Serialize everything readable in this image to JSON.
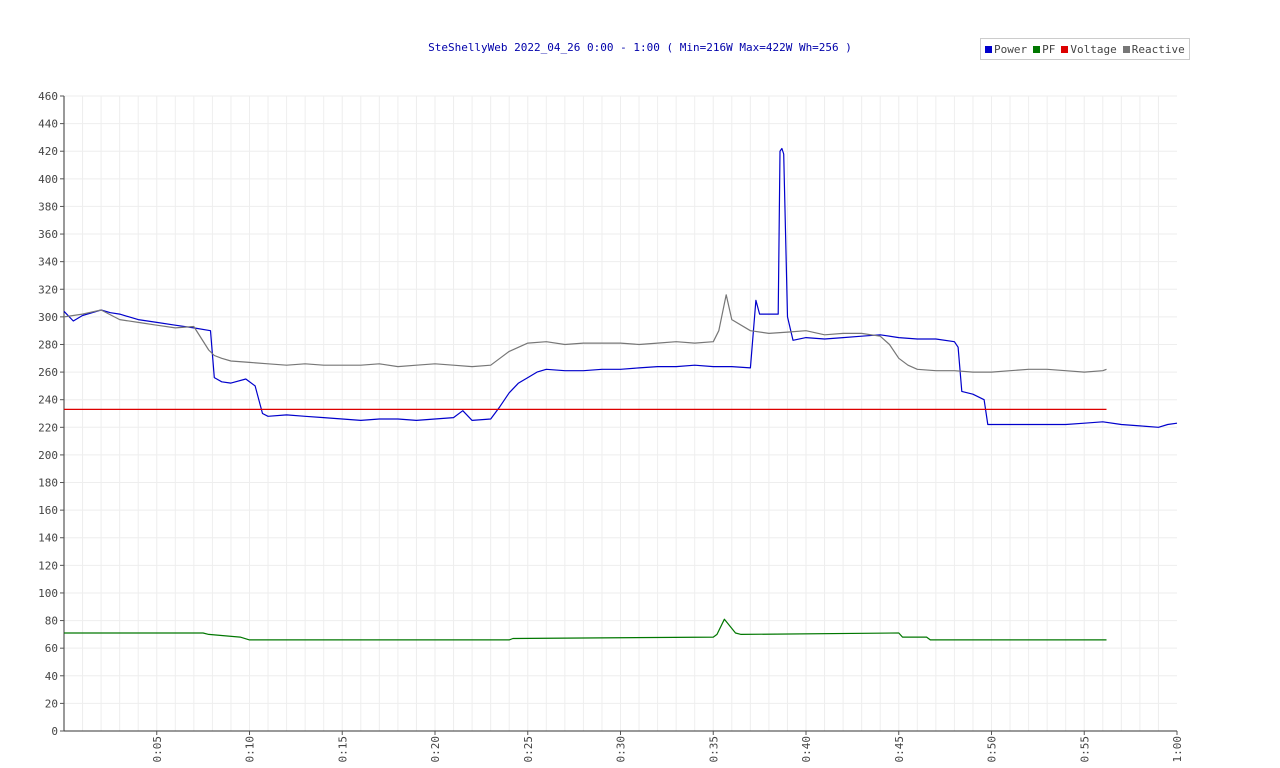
{
  "chart_data": {
    "type": "line",
    "title": "SteShellyWeb 2022_04_26 0:00 - 1:00 ( Min=216W Max=422W  Wh=256 )",
    "ylim": [
      0,
      460
    ],
    "y_ticks": [
      0,
      20,
      40,
      60,
      80,
      100,
      120,
      140,
      160,
      180,
      200,
      220,
      240,
      260,
      280,
      300,
      320,
      340,
      360,
      380,
      400,
      420,
      440,
      460
    ],
    "xlim_minutes": [
      0,
      60
    ],
    "x_tick_minutes": [
      5,
      10,
      15,
      20,
      25,
      30,
      35,
      40,
      45,
      50,
      55,
      60
    ],
    "x_tick_labels": [
      "0:05",
      "0:10",
      "0:15",
      "0:20",
      "0:25",
      "0:30",
      "0:35",
      "0:40",
      "0:45",
      "0:50",
      "0:55",
      "1:00"
    ],
    "grid": true,
    "legend_placement": "top-right",
    "series": [
      {
        "name": "Power",
        "color": "#0000cc",
        "x_minutes": [
          0,
          0.5,
          1,
          2,
          2.5,
          3,
          4,
          5,
          6,
          7,
          7.9,
          8.1,
          8.5,
          9,
          9.8,
          10.3,
          10.7,
          11,
          12,
          13,
          14,
          15,
          16,
          17,
          18,
          19,
          20,
          21,
          21.5,
          22,
          23,
          23.5,
          24,
          24.5,
          25,
          25.5,
          26,
          27,
          28,
          29,
          30,
          31,
          32,
          33,
          34,
          35,
          36,
          37,
          37.3,
          37.5,
          38,
          38.5,
          38.6,
          38.7,
          38.8,
          39,
          39.3,
          40,
          41,
          42,
          43,
          44,
          45,
          46,
          47,
          48,
          48.2,
          48.4,
          49,
          49.6,
          49.8,
          50,
          51,
          52,
          53,
          54,
          55,
          56,
          57,
          58,
          59,
          59.5,
          60
        ],
        "values": [
          304,
          297,
          301,
          305,
          303,
          302,
          298,
          296,
          294,
          292,
          290,
          256,
          253,
          252,
          255,
          250,
          230,
          228,
          229,
          228,
          227,
          226,
          225,
          226,
          226,
          225,
          226,
          227,
          232,
          225,
          226,
          235,
          245,
          252,
          256,
          260,
          262,
          261,
          261,
          262,
          262,
          263,
          264,
          264,
          265,
          264,
          264,
          263,
          312,
          302,
          302,
          302,
          420,
          422,
          418,
          300,
          283,
          285,
          284,
          285,
          286,
          287,
          285,
          284,
          284,
          282,
          278,
          246,
          244,
          240,
          222,
          222,
          222,
          222,
          222,
          222,
          223,
          224,
          222,
          221,
          220,
          222,
          223
        ]
      },
      {
        "name": "PF",
        "color": "#007700",
        "x_minutes": [
          0,
          7.5,
          7.8,
          9.5,
          10,
          24,
          24.2,
          35,
          35.2,
          35.6,
          36.2,
          36.5,
          45,
          45.2,
          46.5,
          46.7,
          56.2
        ],
        "values": [
          71,
          71,
          70,
          68,
          66,
          66,
          67,
          68,
          70,
          81,
          71,
          70,
          71,
          68,
          68,
          66,
          66
        ]
      },
      {
        "name": "Voltage",
        "color": "#dd0000",
        "x_minutes": [
          0,
          56.2
        ],
        "values": [
          233,
          233
        ]
      },
      {
        "name": "Reactive",
        "color": "#777777",
        "x_minutes": [
          0,
          1,
          2,
          3,
          4,
          5,
          6,
          7,
          7.8,
          8.1,
          8.5,
          9,
          10,
          11,
          12,
          13,
          14,
          15,
          16,
          17,
          18,
          19,
          20,
          21,
          22,
          23,
          23.5,
          24,
          25,
          26,
          27,
          28,
          29,
          30,
          31,
          32,
          33,
          34,
          35,
          35.3,
          35.7,
          36,
          37,
          38,
          39,
          40,
          41,
          42,
          43,
          44,
          44.5,
          45,
          45.5,
          46,
          47,
          48,
          49,
          50,
          51,
          52,
          53,
          54,
          55,
          56,
          56.2
        ],
        "values": [
          300,
          302,
          305,
          298,
          296,
          294,
          292,
          293,
          276,
          272,
          270,
          268,
          267,
          266,
          265,
          266,
          265,
          265,
          265,
          266,
          264,
          265,
          266,
          265,
          264,
          265,
          270,
          275,
          281,
          282,
          280,
          281,
          281,
          281,
          280,
          281,
          282,
          281,
          282,
          290,
          316,
          298,
          290,
          288,
          289,
          290,
          287,
          288,
          288,
          286,
          280,
          270,
          265,
          262,
          261,
          261,
          260,
          260,
          261,
          262,
          262,
          261,
          260,
          261,
          262
        ]
      }
    ]
  }
}
